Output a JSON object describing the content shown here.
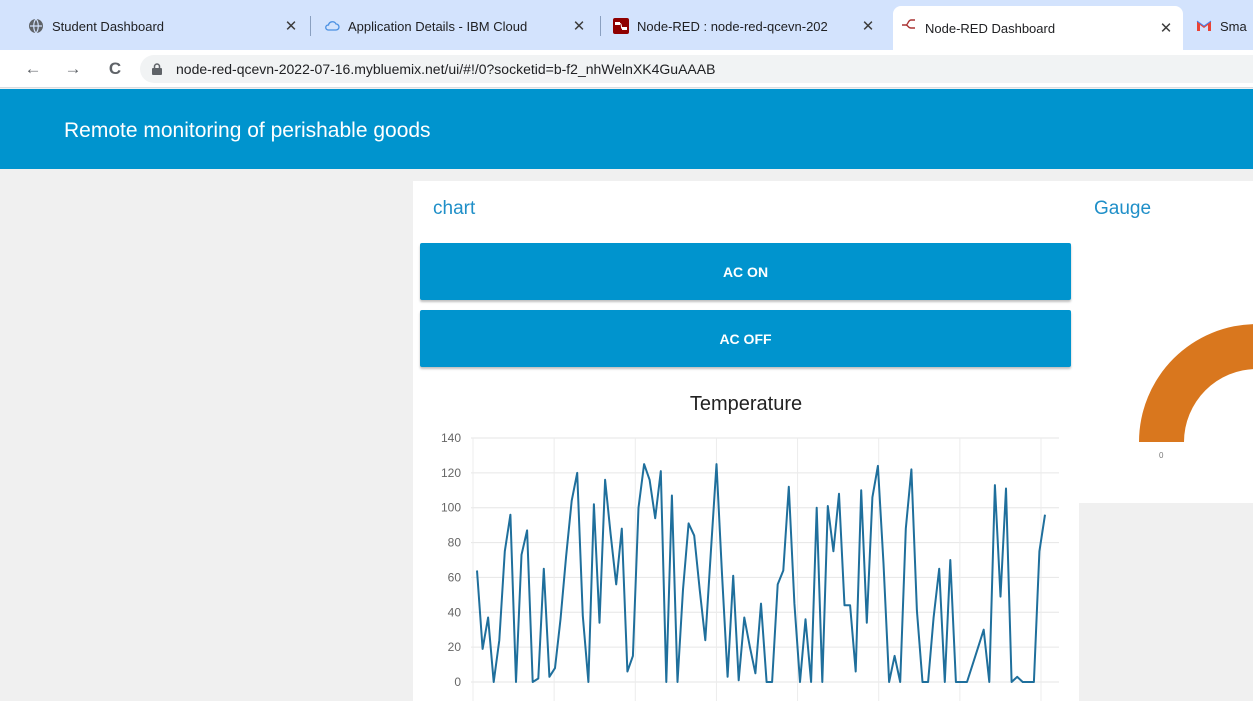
{
  "browser": {
    "tabs": [
      {
        "title": "Student Dashboard",
        "icon": "globe-icon"
      },
      {
        "title": "Application Details - IBM Cloud",
        "icon": "cloud-icon"
      },
      {
        "title": "Node-RED : node-red-qcevn-202",
        "icon": "node-red-icon"
      },
      {
        "title": "Node-RED Dashboard",
        "icon": "node-red-dashboard-icon",
        "active": true
      },
      {
        "title": "Sma",
        "icon": "gmail-icon"
      }
    ],
    "tab_close_glyph": "✕",
    "nav": {
      "back": "←",
      "forward": "→",
      "reload": "C"
    },
    "url": "node-red-qcevn-2022-07-16.mybluemix.net/ui/#!/0?socketid=b-f2_nhWelnXK4GuAAAB"
  },
  "dashboard": {
    "title": "Remote monitoring of perishable goods",
    "accent_color": "#0094ce"
  },
  "chart_group": {
    "title": "chart",
    "buttons": {
      "ac_on": "AC ON",
      "ac_off": "AC OFF"
    }
  },
  "gauge_group": {
    "title": "Gauge",
    "min_label": "0",
    "arc_color": "#d9771e"
  },
  "chart_data": {
    "type": "line",
    "title": "Temperature",
    "xlabel": "",
    "ylabel": "",
    "ylim": [
      0,
      140
    ],
    "yticks": [
      0,
      20,
      40,
      60,
      80,
      100,
      120,
      140
    ],
    "grid": true,
    "series": [
      {
        "color": "#1f6f9c",
        "values": [
          64,
          19,
          37,
          0,
          24,
          75,
          96,
          0,
          73,
          87,
          0,
          2,
          65,
          3,
          8,
          36,
          72,
          104,
          120,
          38,
          0,
          102,
          34,
          116,
          85,
          56,
          88,
          6,
          15,
          100,
          125,
          116,
          94,
          121,
          0,
          107,
          0,
          53,
          91,
          84,
          53,
          24,
          75,
          125,
          62,
          3,
          61,
          1,
          37,
          20,
          5,
          45,
          0,
          0,
          56,
          64,
          112,
          45,
          0,
          36,
          0,
          100,
          0,
          101,
          75,
          108,
          44,
          44,
          6,
          110,
          34,
          106,
          124,
          68,
          0,
          15,
          0,
          88,
          122,
          41,
          0,
          0,
          37,
          65,
          0,
          70,
          0,
          0,
          0,
          10,
          20,
          30,
          0,
          113,
          49,
          111,
          0,
          3,
          0,
          0,
          0,
          75,
          96
        ]
      }
    ]
  }
}
